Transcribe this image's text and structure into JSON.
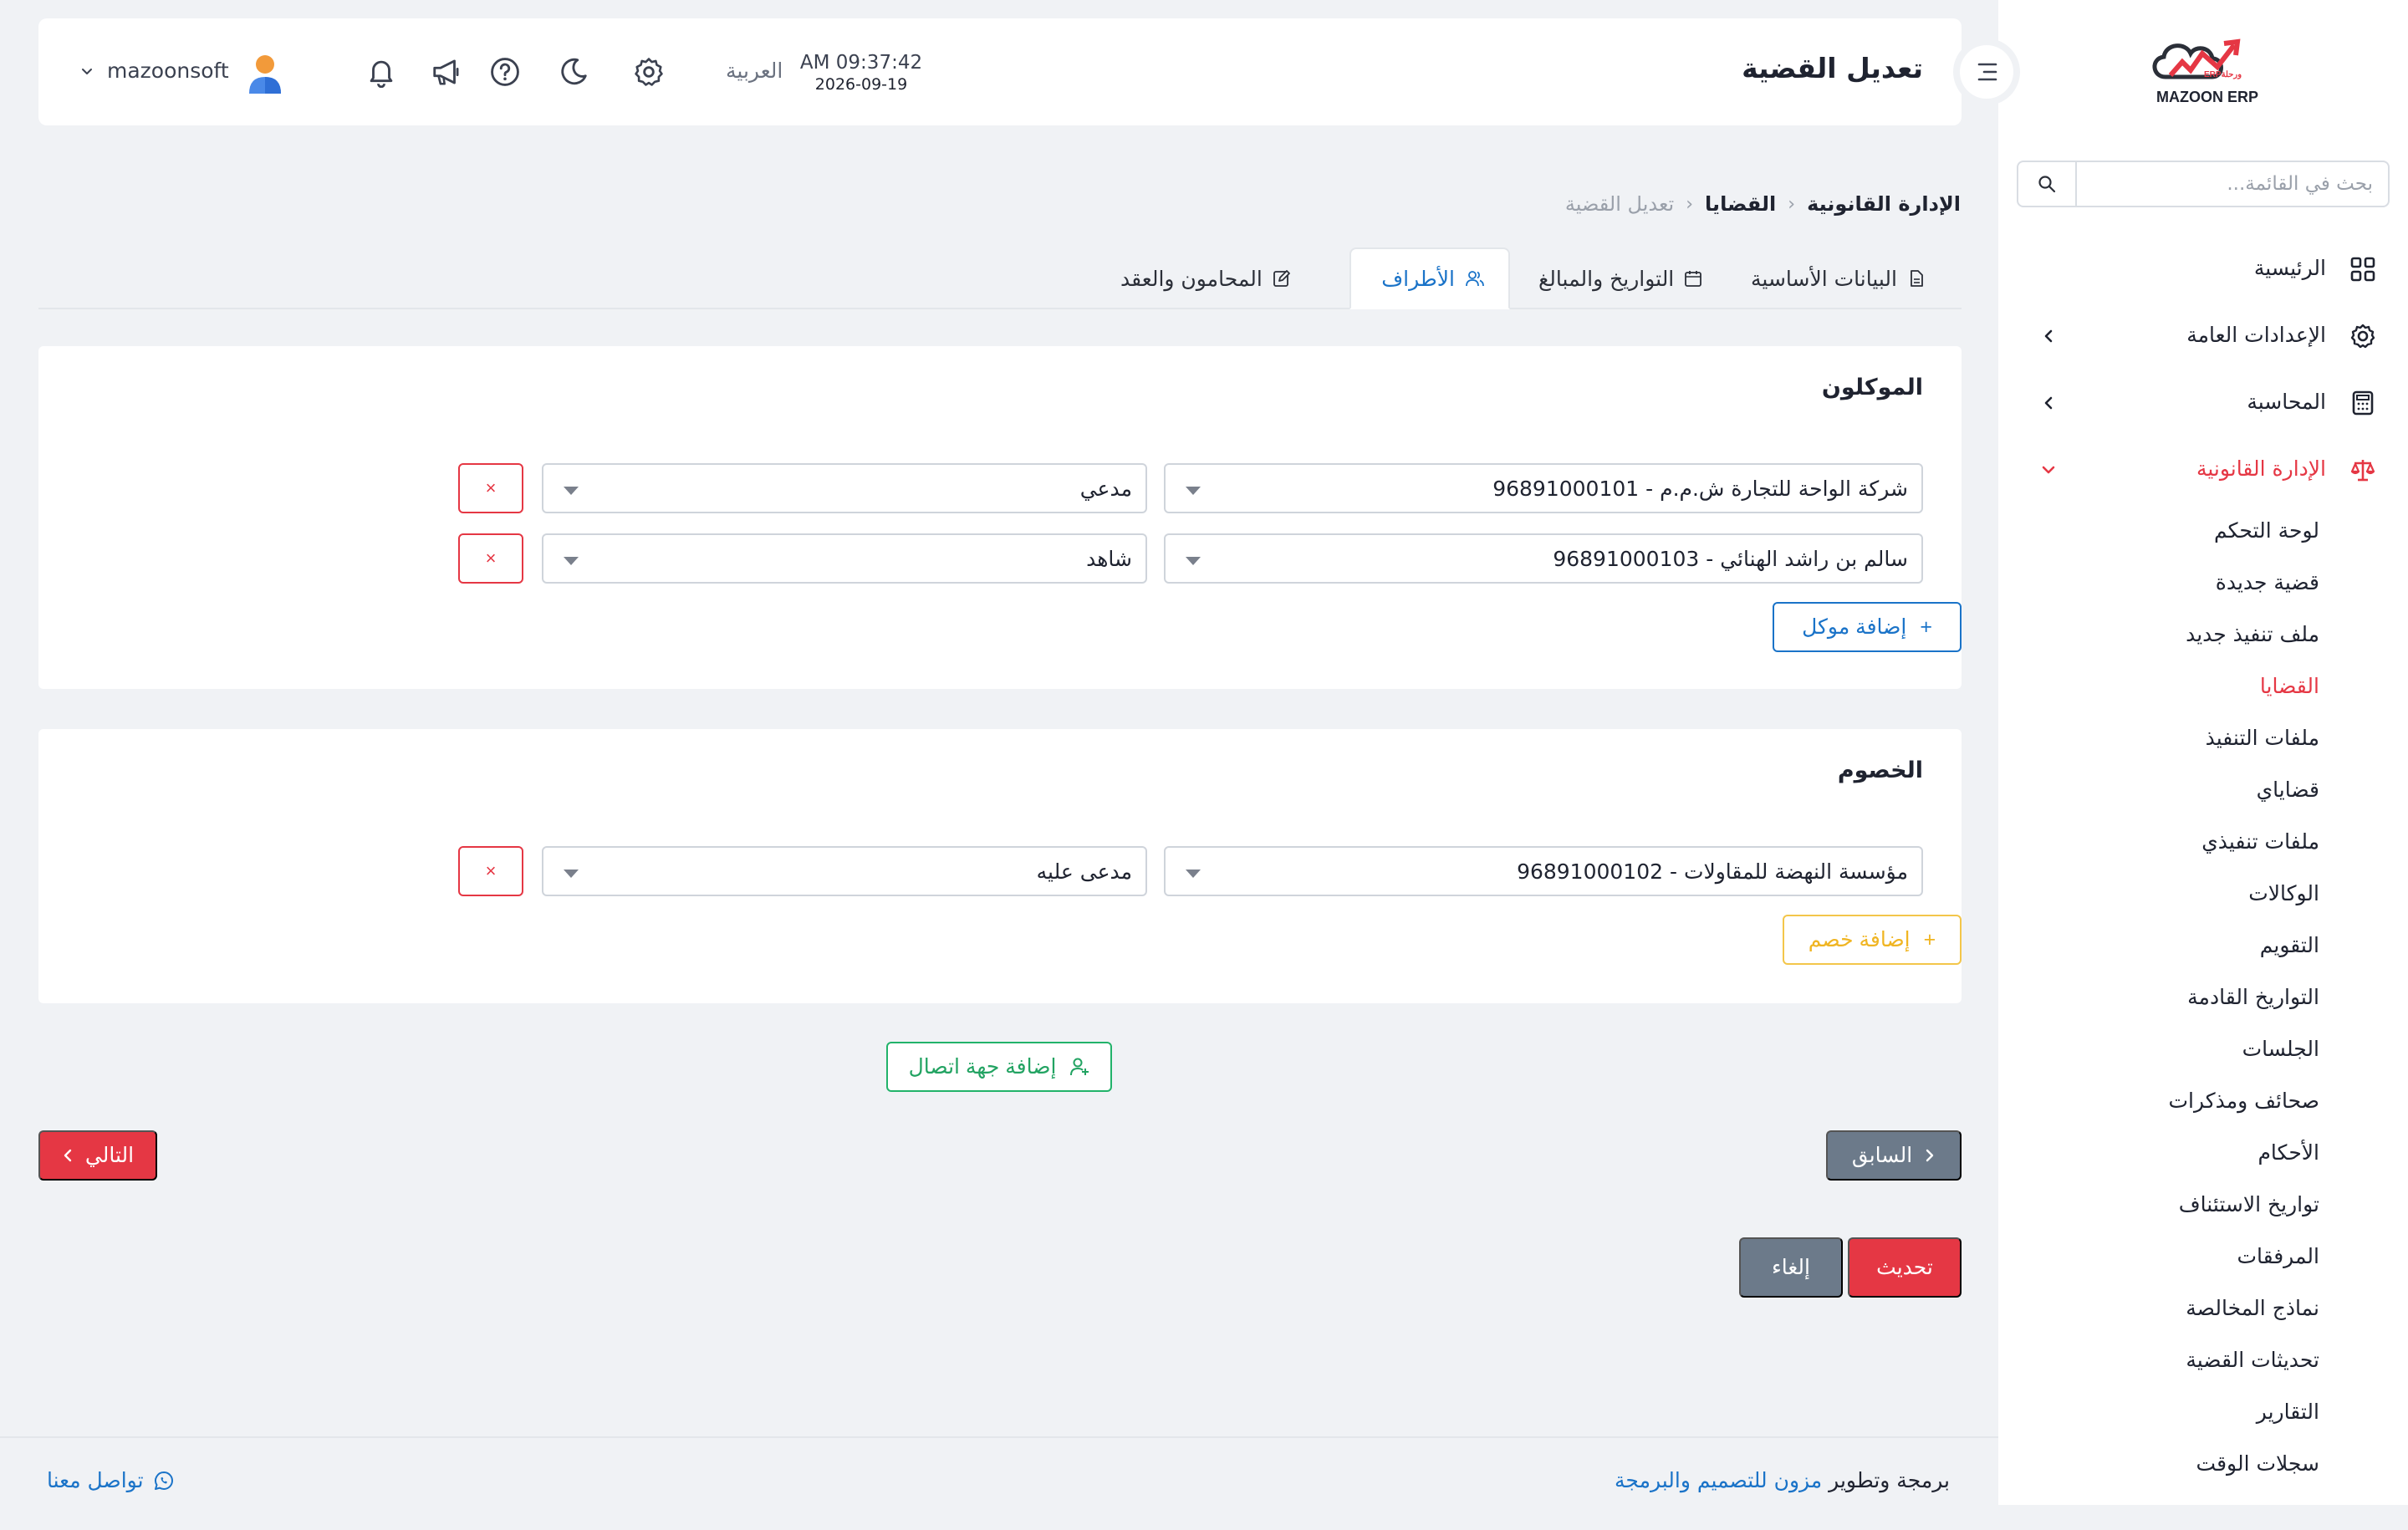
{
  "app": {
    "logo_text": "MAZOON ERP",
    "logo_tag": "ERPورحلة"
  },
  "colors": {
    "accent_red": "#e53744",
    "accent_blue": "#1a73c8",
    "accent_green": "#22a362",
    "accent_yellow": "#f0b522",
    "muted_slate": "#6c7a8a"
  },
  "sidebar": {
    "search_placeholder": "بحث في القائمة...",
    "main_items": [
      {
        "label": "الرئيسية",
        "icon": "grid-icon"
      },
      {
        "label": "الإعدادات العامة",
        "icon": "gear-icon",
        "has_chevron": true
      },
      {
        "label": "المحاسبة",
        "icon": "calculator-icon",
        "has_chevron": true
      },
      {
        "label": "الإدارة القانونية",
        "icon": "scales-icon",
        "has_chevron": true,
        "expanded": true,
        "active": true
      }
    ],
    "sub_items": [
      {
        "label": "لوحة التحكم"
      },
      {
        "label": "قضية جديدة"
      },
      {
        "label": "ملف تنفيذ جديد"
      },
      {
        "label": "القضايا",
        "active": true
      },
      {
        "label": "ملفات التنفيذ"
      },
      {
        "label": "قضاياي"
      },
      {
        "label": "ملفات تنفيذي"
      },
      {
        "label": "الوكالات"
      },
      {
        "label": "التقويم"
      },
      {
        "label": "التواريخ القادمة"
      },
      {
        "label": "الجلسات"
      },
      {
        "label": "صحائف ومذكرات"
      },
      {
        "label": "الأحكام"
      },
      {
        "label": "تواريخ الاستئناف"
      },
      {
        "label": "المرفقات"
      },
      {
        "label": "نماذج المخالصة"
      },
      {
        "label": "تحديثات القضية"
      },
      {
        "label": "التقارير"
      },
      {
        "label": "سجلات الوقت"
      }
    ]
  },
  "header": {
    "title": "تعديل القضية",
    "time": "AM 09:37:42",
    "date": "2026-09-19",
    "language": "العربية",
    "user_name": "mazoonsoft"
  },
  "breadcrumb": {
    "items": [
      "الإدارة القانونية",
      "القضايا",
      "تعديل القضية"
    ]
  },
  "tabs": [
    {
      "label": "البيانات الأساسية",
      "icon": "document-icon"
    },
    {
      "label": "التواريخ والمبالغ",
      "icon": "calendar-icon"
    },
    {
      "label": "الأطراف",
      "icon": "users-icon",
      "active": true
    },
    {
      "label": "المحامون والعقد",
      "icon": "edit-icon"
    }
  ],
  "clients": {
    "title": "الموكلون",
    "rows": [
      {
        "party": "شركة الواحة للتجارة ش.م.م - 96891000101",
        "role": "مدعي"
      },
      {
        "party": "سالم بن راشد الهنائي - 96891000103",
        "role": "شاهد"
      }
    ],
    "add_label": "إضافة موكل"
  },
  "opponents": {
    "title": "الخصوم",
    "rows": [
      {
        "party": "مؤسسة النهضة للمقاولات - 96891000102",
        "role": "مدعى عليه"
      }
    ],
    "add_label": "إضافة خصم"
  },
  "add_contact_label": "إضافة جهة اتصال",
  "navigation": {
    "prev_label": "السابق",
    "next_label": "التالي"
  },
  "actions": {
    "update_label": "تحديث",
    "cancel_label": "إلغاء"
  },
  "footer": {
    "credit_prefix": "برمجة وتطوير",
    "credit_link": "مزون للتصميم والبرمجة",
    "contact_label": "تواصل معنا"
  },
  "remove_symbol": "×",
  "plus_symbol": "+"
}
